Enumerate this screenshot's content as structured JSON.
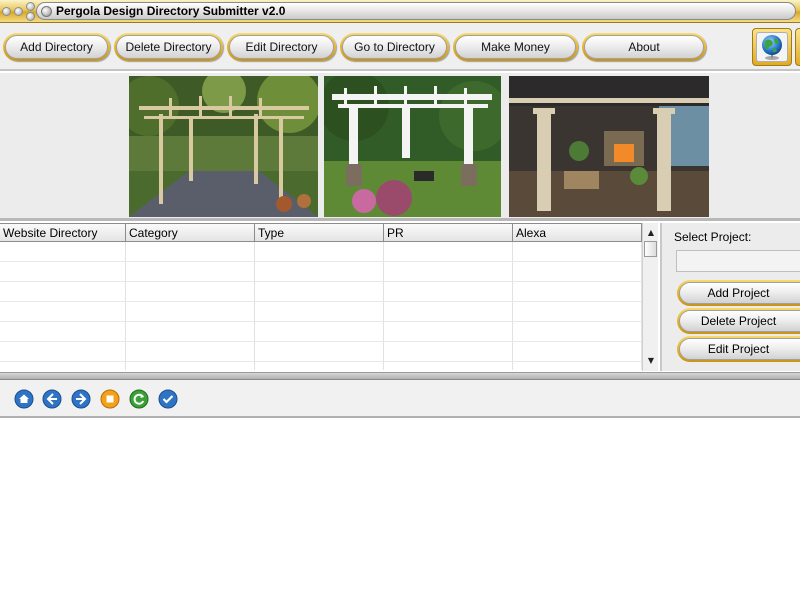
{
  "window": {
    "title": "Pergola Design Directory Submitter v2.0"
  },
  "toolbar": {
    "buttons": [
      {
        "label": "Add Directory"
      },
      {
        "label": "Delete Directory"
      },
      {
        "label": "Edit Directory"
      },
      {
        "label": "Go to Directory"
      },
      {
        "label": "Make Money"
      },
      {
        "label": "About"
      }
    ],
    "globe_icon": "globe-icon"
  },
  "grid": {
    "columns": [
      "Website Directory",
      "Category",
      "Type",
      "PR",
      "Alexa"
    ],
    "rows": []
  },
  "project_panel": {
    "label": "Select Project:",
    "selected_value": "",
    "buttons": [
      {
        "label": "Add Project"
      },
      {
        "label": "Delete Project"
      },
      {
        "label": "Edit Project"
      }
    ]
  },
  "navbar": {
    "icons": [
      "home-icon",
      "back-icon",
      "forward-icon",
      "stop-icon",
      "refresh-icon",
      "check-icon"
    ]
  },
  "colors": {
    "accent_gold": "#e6b52e",
    "nav_blue": "#2f74c4",
    "stop_orange": "#f2a11a",
    "refresh_green": "#3aa038"
  }
}
